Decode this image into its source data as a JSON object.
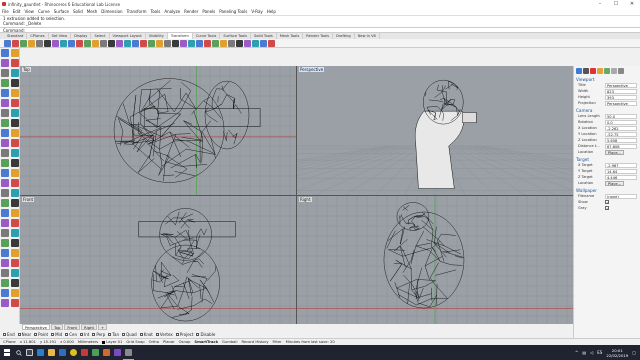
{
  "window": {
    "title": "infinity_gauntlet - Rhinoceros 6 Educational Lab License",
    "buttons": [
      "–",
      "☐",
      "✕"
    ]
  },
  "menu": [
    "File",
    "Edit",
    "View",
    "Curve",
    "Surface",
    "Solid",
    "Mesh",
    "Dimension",
    "Transform",
    "Tools",
    "Analyze",
    "Render",
    "Panels",
    "Paneling Tools",
    "V-Ray",
    "Help"
  ],
  "command_history": [
    "1 extrusion added to selection.",
    "Command: _Delete"
  ],
  "command_prompt": "Command:",
  "toolbar_tabs": [
    "Standard",
    "CPlanes",
    "Set View",
    "Display",
    "Select",
    "Viewport Layout",
    "Visibility",
    "Transform",
    "Curve Tools",
    "Surface Tools",
    "Solid Tools",
    "Mesh Tools",
    "Render Tools",
    "Drafting",
    "New in V6"
  ],
  "active_toolbar_tab": "Transform",
  "viewports": {
    "top": "Top",
    "perspective": "Perspective",
    "front": "Front",
    "right": "Right"
  },
  "viewport_tabs": [
    "Perspective",
    "Top",
    "Front",
    "Right",
    "+"
  ],
  "osnaps": [
    "End",
    "Near",
    "Point",
    "Mid",
    "Cen",
    "Int",
    "Perp",
    "Tan",
    "Quad",
    "Knot",
    "Vertex",
    "Project",
    "Disable"
  ],
  "status": {
    "cplane": "CPlane",
    "x": "x 11.801",
    "y": "y 15.191",
    "z": "z 0.000",
    "units": "Millimeters",
    "layer": "Layer 01",
    "items": [
      "Grid Snap",
      "Ortho",
      "Planar",
      "Osnap",
      "SmartTrack",
      "Gumball",
      "Record History",
      "Filter",
      "Minutes from last save: 20"
    ],
    "bold_item": "SmartTrack"
  },
  "properties": {
    "viewport_header": "Viewport",
    "viewport_rows": [
      {
        "k": "Title",
        "v": "Perspective"
      },
      {
        "k": "Width",
        "v": "823"
      },
      {
        "k": "Height",
        "v": "393"
      },
      {
        "k": "Projection",
        "v": "Perspective"
      }
    ],
    "camera_header": "Camera",
    "camera_rows": [
      {
        "k": "Lens Length",
        "v": "50.0"
      },
      {
        "k": "Rotation",
        "v": "0.0"
      },
      {
        "k": "X Location",
        "v": "-2.262"
      },
      {
        "k": "Y Location",
        "v": "-52.75"
      },
      {
        "k": "Z Location",
        "v": "5.658"
      },
      {
        "k": "Distance t...",
        "v": "67.808"
      }
    ],
    "camera_location_label": "Location",
    "place_button": "Place...",
    "target_header": "Target",
    "target_rows": [
      {
        "k": "X Target",
        "v": "-2.987"
      },
      {
        "k": "Y Target",
        "v": "14.64"
      },
      {
        "k": "Z Target",
        "v": "4.446"
      }
    ],
    "target_location_label": "Location",
    "wallpaper_header": "Wallpaper",
    "wallpaper_rows": [
      {
        "k": "Filename",
        "v": "(none)"
      }
    ],
    "show_label": "Show",
    "gray_label": "Gray"
  },
  "taskbar": {
    "language": "ES",
    "time": "20:01",
    "date": "22/02/2019"
  },
  "colors": {
    "viewport_bg": "#9aa0a6",
    "grid_line": "#8a9096",
    "grid_axis_x": "#b04040",
    "grid_axis_y": "#40a040",
    "wire": "#111111",
    "accent": "#1a4f9a"
  }
}
